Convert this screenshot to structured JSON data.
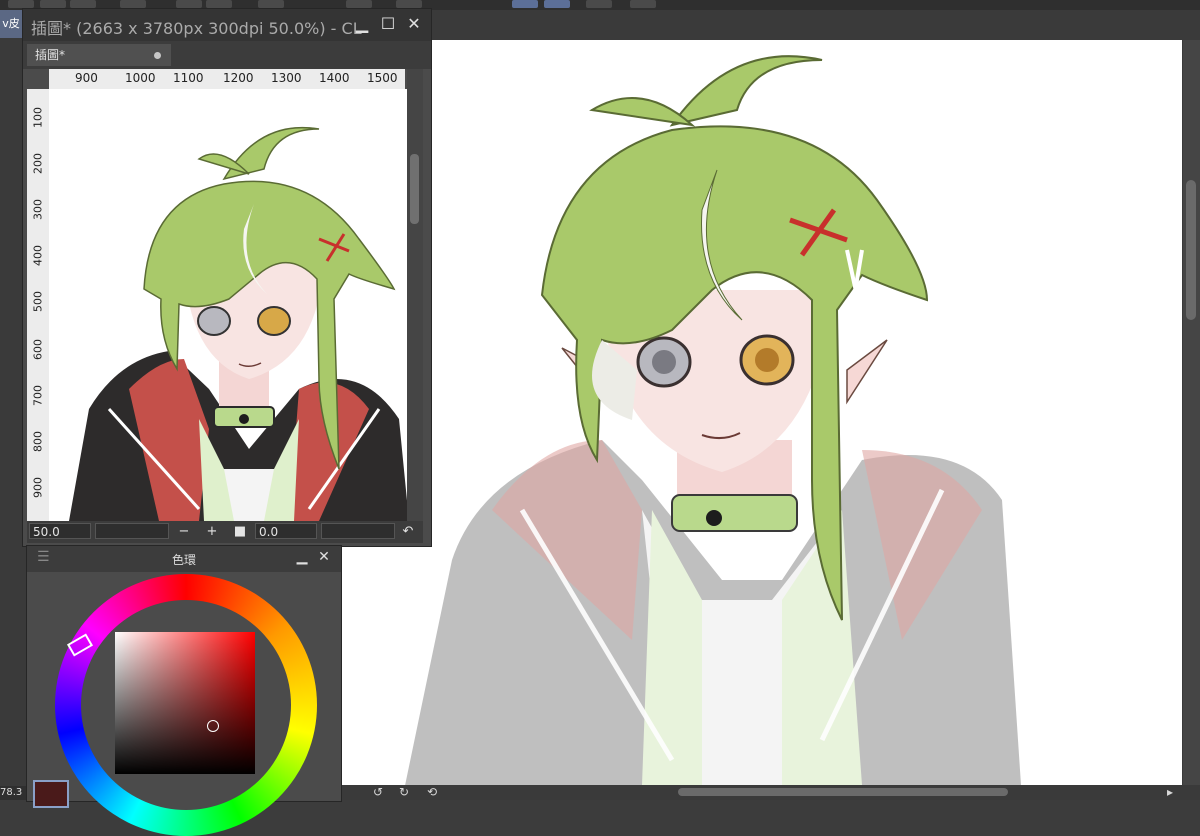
{
  "navigator": {
    "title": "插圖* (2663 x 3780px 300dpi 50.0%)  - CL",
    "tab_label": "插圖*",
    "ruler_top": [
      "900",
      "1000",
      "1100",
      "1200",
      "1300",
      "1400",
      "1500"
    ],
    "ruler_left": [
      "100",
      "200",
      "300",
      "400",
      "500",
      "600",
      "700",
      "800",
      "900"
    ],
    "zoom_value": "50.0",
    "angle_value": "0.0",
    "minimize_icon": "minimize-icon",
    "maximize_icon": "maximize-icon",
    "close_icon": "close-icon"
  },
  "color_panel": {
    "title": "色環",
    "current_color": "#4a1a1a",
    "hue_color": "#ff0000"
  },
  "left_tab_label": "v皮",
  "status": {
    "zoom": "78.3"
  },
  "colors": {
    "hair": "#a9c96a",
    "hair_shadow": "#7e9e48",
    "skin": "#f7e2df",
    "jacket": "#2d2b2b",
    "hood_lining": "#c4504a",
    "collar": "#b9d98c"
  }
}
